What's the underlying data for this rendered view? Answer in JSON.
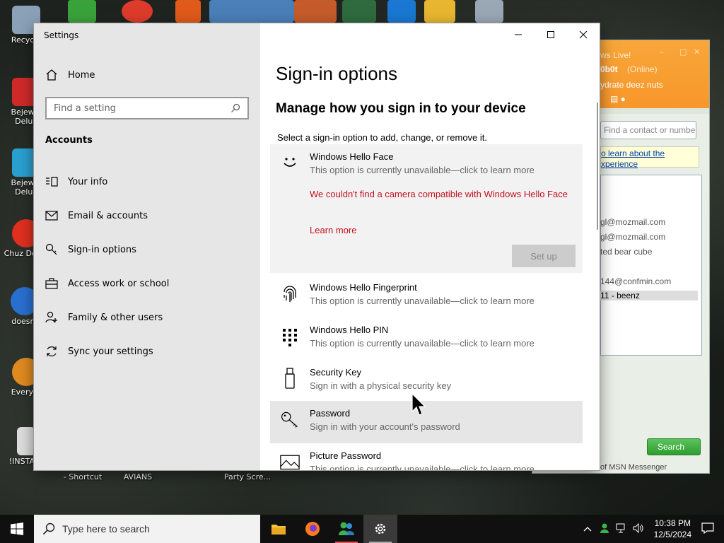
{
  "desktop": {
    "icons": [
      {
        "label": "Recycle",
        "color": "#8aa1b8"
      },
      {
        "label": "Bejewel Delux",
        "color": "#d02a2a"
      },
      {
        "label": "Bejewel Delux",
        "color": "#2aa0d0"
      },
      {
        "label": "Chuz Delux",
        "color": "#e03020"
      },
      {
        "label": "doesnt",
        "color": "#2a70d0"
      },
      {
        "label": "Everyth",
        "color": "#e08a20"
      },
      {
        "label": "!INSTALL",
        "color": "#dddddd"
      }
    ],
    "bottom_labels": [
      "- Shortcut",
      "AVIANS",
      "Party Scre..."
    ]
  },
  "msn": {
    "title_fragment": "ws Live!",
    "user": "0b0t",
    "status": "(Online)",
    "personal_message": "ydrate deez nuts",
    "search_placeholder": "Find a contact or numbe",
    "info_link": "o learn about the xperience",
    "contacts": [
      "gl@mozmail.com",
      "gl@mozmail.com",
      "ted bear cube",
      "144@confmin.com",
      "11 - beenz"
    ],
    "search_button": "Search",
    "footer": "of MSN Messenger"
  },
  "settings": {
    "window_title": "Settings",
    "home_label": "Home",
    "search_placeholder": "Find a setting",
    "section_title": "Accounts",
    "nav": [
      {
        "label": "Your info",
        "icon": "person-card-icon"
      },
      {
        "label": "Email & accounts",
        "icon": "mail-icon"
      },
      {
        "label": "Sign-in options",
        "icon": "key-icon"
      },
      {
        "label": "Access work or school",
        "icon": "briefcase-icon"
      },
      {
        "label": "Family & other users",
        "icon": "person-add-icon"
      },
      {
        "label": "Sync your settings",
        "icon": "sync-icon"
      }
    ],
    "page_title": "Sign-in options",
    "subtitle": "Manage how you sign in to your device",
    "hint": "Select a sign-in option to add, change, or remove it.",
    "options": [
      {
        "title": "Windows Hello Face",
        "desc": "This option is currently unavailable—click to learn more"
      },
      {
        "title": "Windows Hello Fingerprint",
        "desc": "This option is currently unavailable—click to learn more"
      },
      {
        "title": "Windows Hello PIN",
        "desc": "This option is currently unavailable—click to learn more"
      },
      {
        "title": "Security Key",
        "desc": "Sign in with a physical security key"
      },
      {
        "title": "Password",
        "desc": "Sign in with your account's password"
      },
      {
        "title": "Picture Password",
        "desc": "This option is currently unavailable—click to learn more"
      }
    ],
    "face_error": "We couldn't find a camera compatible with Windows Hello Face",
    "learn_more": "Learn more",
    "setup_button": "Set up"
  },
  "taskbar": {
    "search_placeholder": "Type here to search",
    "time": "10:38 PM",
    "date": "12/5/2024"
  },
  "colors": {
    "error_red": "#c50f1f",
    "sidebar_bg": "#e6e6e6",
    "msn_orange": "#f7972a"
  }
}
